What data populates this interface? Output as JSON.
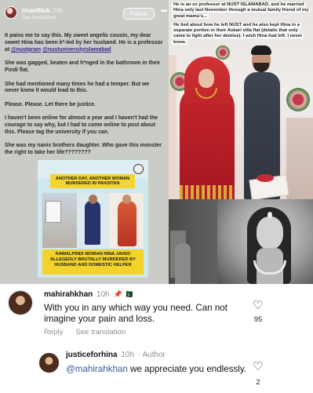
{
  "post": {
    "username": "imanfttuk",
    "time": "23h",
    "see_translation": "See translation",
    "follow_label": "Follow",
    "more_label": "•••",
    "p1_before": "It pains me to say this. My sweet angelic cousin, my dear sweet Hina has been k*-led by her husband. He is a professor at ",
    "p1_mention1": "@nustgram",
    "p1_sep": " ",
    "p1_mention2": "@nustuniversityislamabad",
    "p2": "She was gagged, beaten and h*nged in the bathroom in their Pindi flat.",
    "p3": "She had mentioned many times he had a temper. But we never knew it would lead to this.",
    "p4": "Please. Please. Let there be justice.",
    "p5": "I haven't been online for almost a year and I haven't had the courage to say why, but I had to come online to post about this. Please tag the university if you can.",
    "p6": "She was my nanis brothers daughter. Who gave this monster the right to take her life????????"
  },
  "news_card": {
    "badge": "ANOTHER DAY, ANOTHER WOMAN MURDERED IN PAKISTAN",
    "headline": "RAWALPINDI WOMAN HINA JAVED ALLEGEDLY BRUTALLY MURDERED BY HUSBAND AND DOMESTIC HELPER"
  },
  "wedding_photo": {
    "caption1": "He is an ex professor at NUST ISLAMABAD, and he married Hina only last November through a mutual family friend of my great mamu's...",
    "caption2": "He lied about how he left NUST and he also kept Hina in a separate portion in their Askari villa flat (details that only came to light after her demise). I wish Hina had left. I never knew."
  },
  "comments": [
    {
      "username": "mahirahkhan",
      "time": "10h",
      "emoji": "📌 🇵🇰",
      "text": "With you in any which way you need. Can not imagine your pain and loss.",
      "reply_label": "Reply",
      "translate_label": "See translation",
      "likes": "95"
    }
  ],
  "reply": {
    "username": "justiceforhina",
    "time": "10h",
    "author_label": "· Author",
    "mention": "@mahirahkhan",
    "text": " we appreciate you endlessly.",
    "likes": "2"
  },
  "icons": {
    "heart": "♡"
  }
}
